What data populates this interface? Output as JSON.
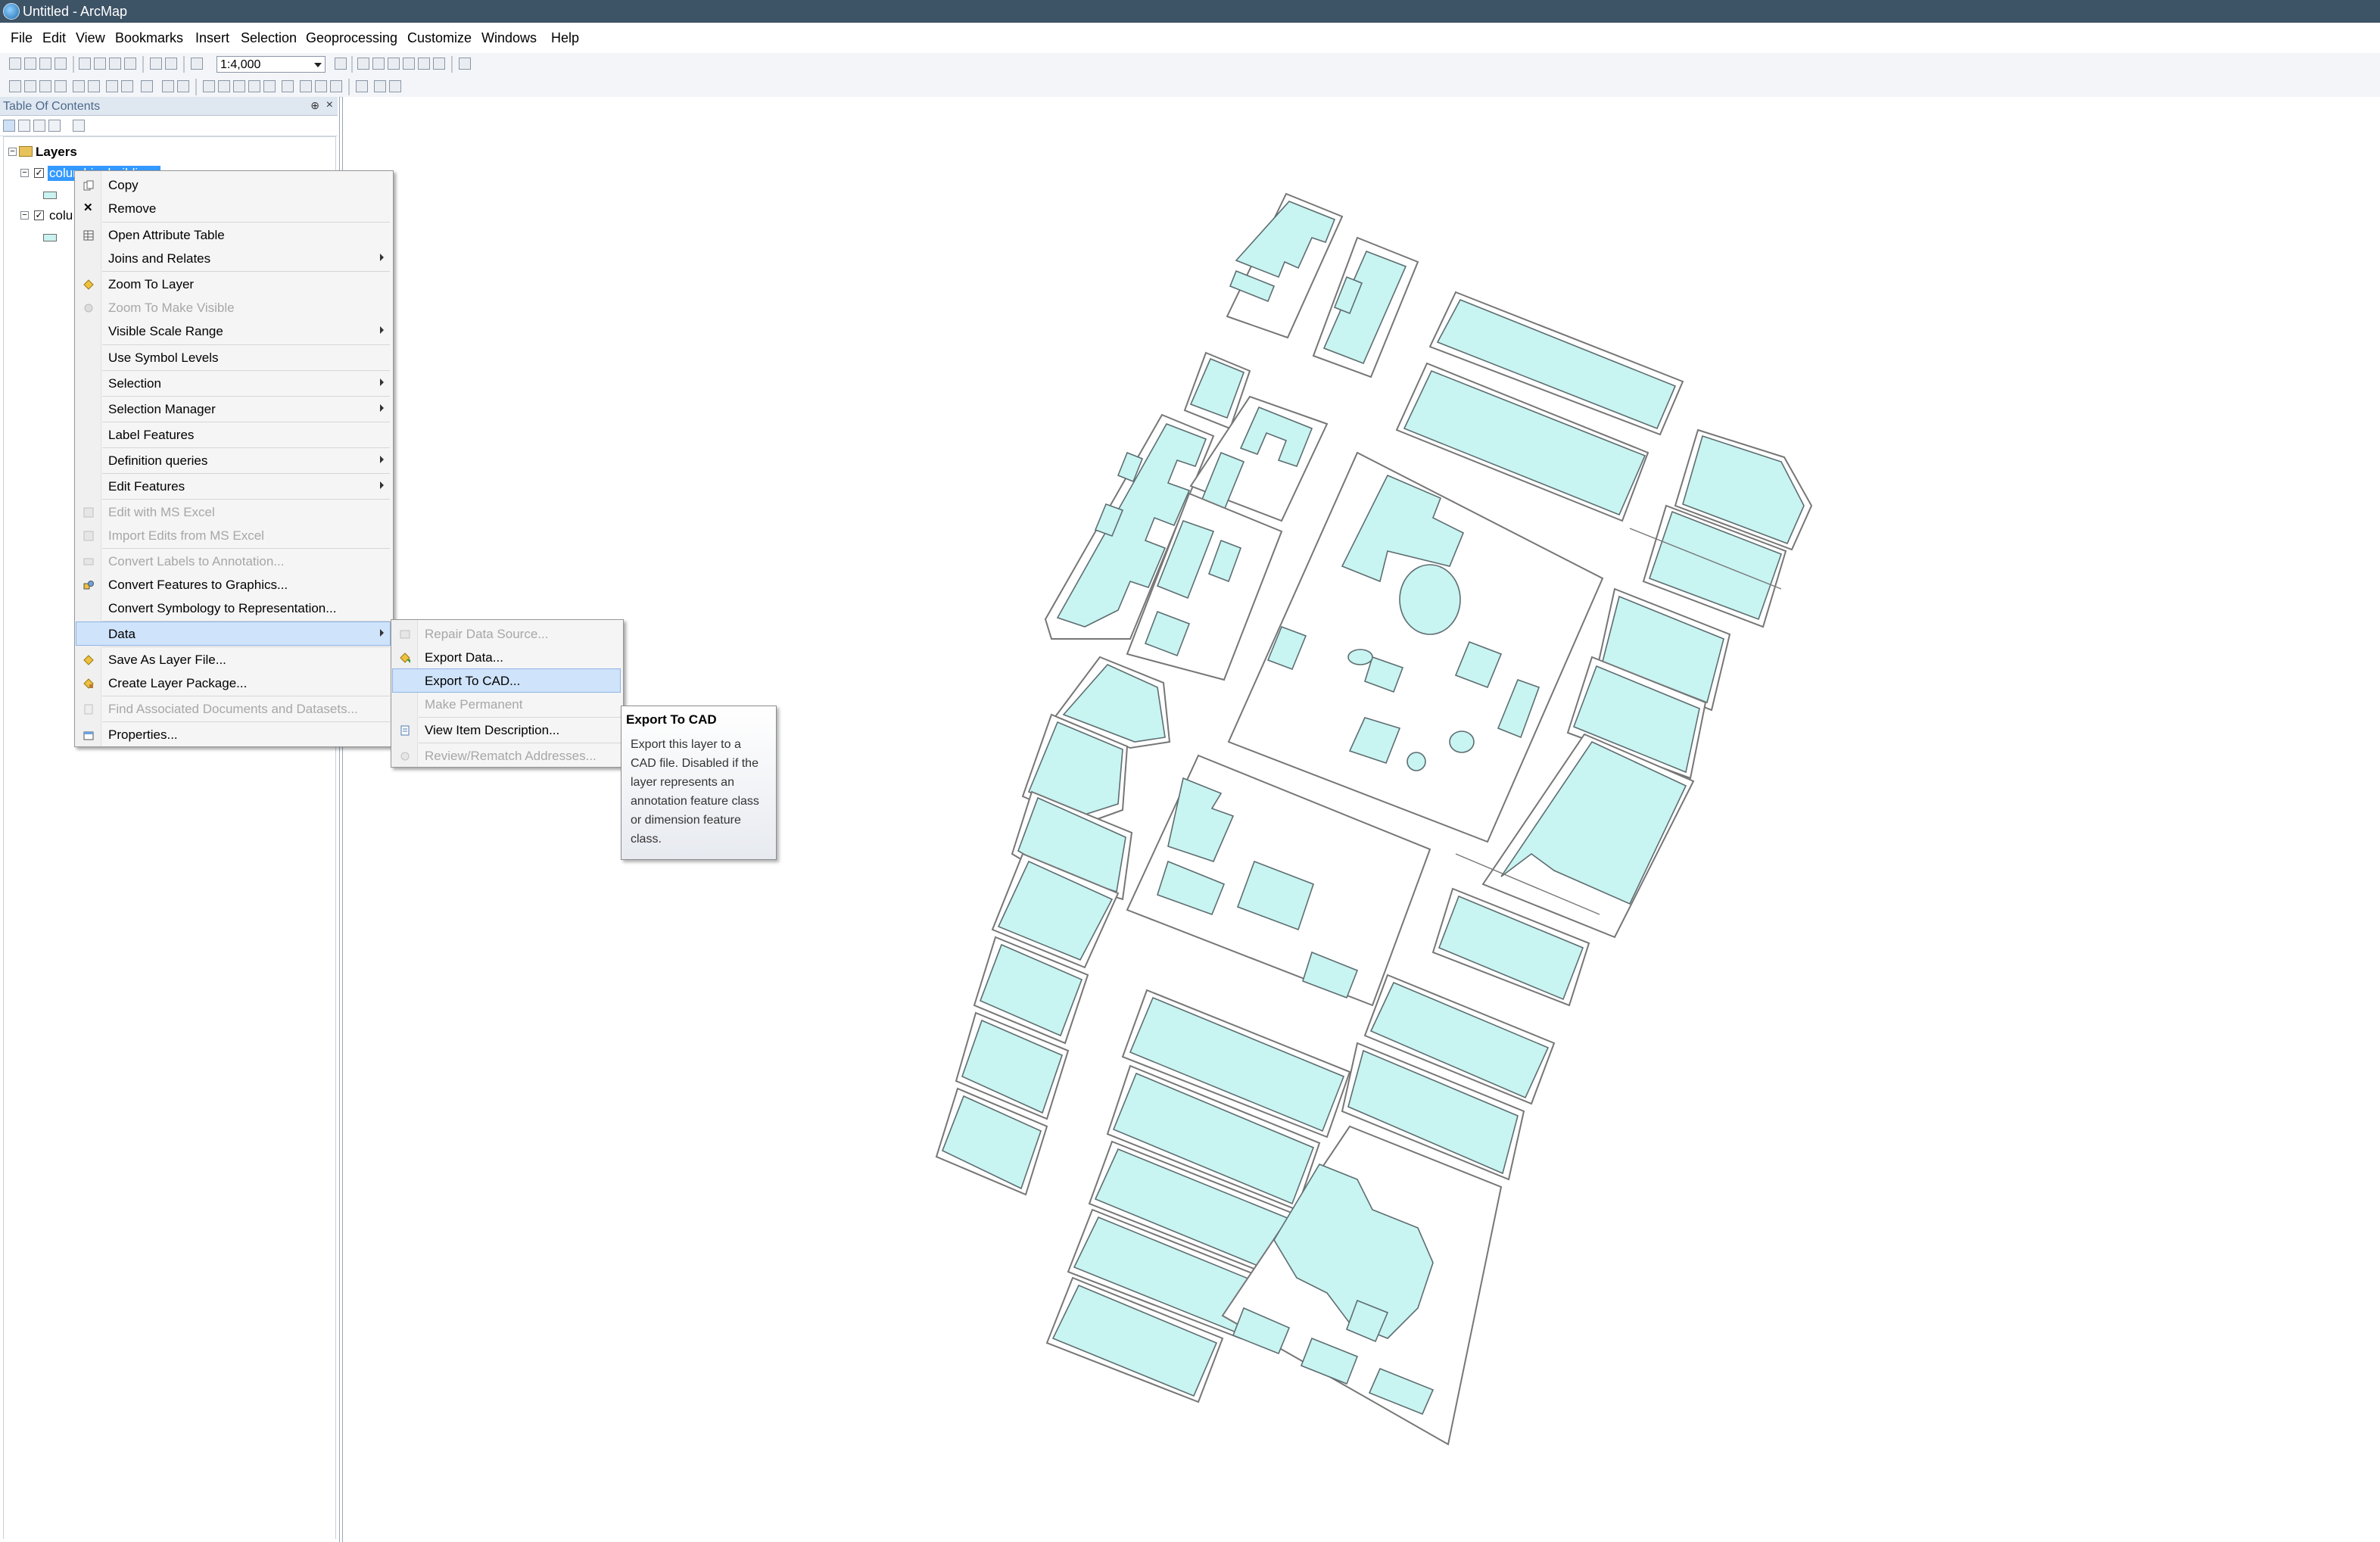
{
  "window": {
    "title": "Untitled - ArcMap"
  },
  "menubar": [
    "File",
    "Edit",
    "View",
    "Bookmarks",
    "Insert",
    "Selection",
    "Geoprocessing",
    "Customize",
    "Windows",
    "Help"
  ],
  "toolbar": {
    "scale_value": "1:4,000"
  },
  "toc": {
    "title": "Table Of Contents",
    "root": "Layers",
    "layers": [
      {
        "name": "columbia_buildings",
        "selected": true
      },
      {
        "name": "colu",
        "selected": false
      }
    ]
  },
  "context_menu": {
    "items": [
      {
        "label": "Copy",
        "icon": "copy-icon",
        "disabled": false,
        "submenu": false
      },
      {
        "label": "Remove",
        "icon": "remove-icon",
        "disabled": false,
        "submenu": false
      },
      {
        "label": "Open Attribute Table",
        "icon": "table-icon",
        "disabled": false,
        "submenu": false
      },
      {
        "label": "Joins and Relates",
        "icon": "",
        "disabled": false,
        "submenu": true
      },
      {
        "label": "Zoom To Layer",
        "icon": "zoom-layer-icon",
        "disabled": false,
        "submenu": false
      },
      {
        "label": "Zoom To Make Visible",
        "icon": "zoom-visible-icon",
        "disabled": true,
        "submenu": false
      },
      {
        "label": "Visible Scale Range",
        "icon": "",
        "disabled": false,
        "submenu": true
      },
      {
        "label": "Use Symbol Levels",
        "icon": "",
        "disabled": false,
        "submenu": false
      },
      {
        "label": "Selection",
        "icon": "",
        "disabled": false,
        "submenu": true
      },
      {
        "label": "Selection Manager",
        "icon": "",
        "disabled": false,
        "submenu": true
      },
      {
        "label": "Label Features",
        "icon": "",
        "disabled": false,
        "submenu": false
      },
      {
        "label": "Definition queries",
        "icon": "",
        "disabled": false,
        "submenu": true
      },
      {
        "label": "Edit Features",
        "icon": "",
        "disabled": false,
        "submenu": true
      },
      {
        "label": "Edit with MS Excel",
        "icon": "excel-icon",
        "disabled": true,
        "submenu": false
      },
      {
        "label": "Import Edits from MS Excel",
        "icon": "excel-import-icon",
        "disabled": true,
        "submenu": false
      },
      {
        "label": "Convert Labels to Annotation...",
        "icon": "annotation-icon",
        "disabled": true,
        "submenu": false
      },
      {
        "label": "Convert Features to Graphics...",
        "icon": "graphics-icon",
        "disabled": false,
        "submenu": false
      },
      {
        "label": "Convert Symbology to Representation...",
        "icon": "",
        "disabled": false,
        "submenu": false
      },
      {
        "label": "Data",
        "icon": "",
        "disabled": false,
        "submenu": true,
        "highlighted": true
      },
      {
        "label": "Save As Layer File...",
        "icon": "layer-file-icon",
        "disabled": false,
        "submenu": false
      },
      {
        "label": "Create Layer Package...",
        "icon": "layer-package-icon",
        "disabled": false,
        "submenu": false
      },
      {
        "label": "Find Associated Documents and Datasets...",
        "icon": "documents-icon",
        "disabled": true,
        "submenu": false
      },
      {
        "label": "Properties...",
        "icon": "properties-icon",
        "disabled": false,
        "submenu": false
      }
    ]
  },
  "data_submenu": {
    "items": [
      {
        "label": "Repair Data Source...",
        "icon": "repair-icon",
        "disabled": true
      },
      {
        "label": "Export Data...",
        "icon": "export-data-icon",
        "disabled": false
      },
      {
        "label": "Export To CAD...",
        "icon": "",
        "disabled": false,
        "highlighted": true
      },
      {
        "label": "Make Permanent",
        "icon": "",
        "disabled": true
      },
      {
        "label": "View Item Description...",
        "icon": "description-icon",
        "disabled": false
      },
      {
        "label": "Review/Rematch Addresses...",
        "icon": "rematch-icon",
        "disabled": true
      }
    ]
  },
  "tooltip": {
    "title": "Export To CAD",
    "body": "Export this layer to a CAD file. Disabled if the layer represents an annotation feature class or dimension feature class."
  },
  "colors": {
    "titlebar": "#3d5366",
    "building_fill": "#c8f4f2",
    "menu_highlight": "#cfe3fb",
    "selection_blue": "#3399ff"
  }
}
